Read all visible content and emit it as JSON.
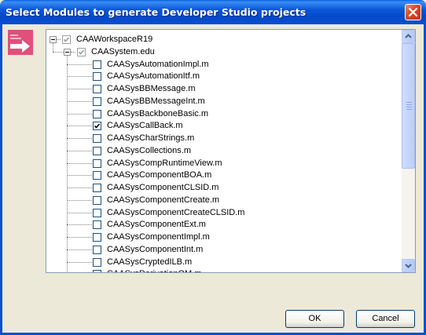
{
  "window": {
    "title": "Select Modules to generate Developer Studio projects"
  },
  "icons": {
    "side": "arrow-right-icon",
    "close": "close-icon"
  },
  "tree": {
    "root": {
      "label": "CAAWorkspaceR19",
      "checked": true,
      "expanded": true
    },
    "framework": {
      "label": "CAASystem.edu",
      "checked": true,
      "expanded": true
    },
    "modules": [
      {
        "label": "CAASysAutomationImpl.m",
        "checked": false
      },
      {
        "label": "CAASysAutomationItf.m",
        "checked": false
      },
      {
        "label": "CAASysBBMessage.m",
        "checked": false
      },
      {
        "label": "CAASysBBMessageInt.m",
        "checked": false
      },
      {
        "label": "CAASysBackboneBasic.m",
        "checked": false
      },
      {
        "label": "CAASysCallBack.m",
        "checked": true
      },
      {
        "label": "CAASysCharStrings.m",
        "checked": false
      },
      {
        "label": "CAASysCollections.m",
        "checked": false
      },
      {
        "label": "CAASysCompRuntimeView.m",
        "checked": false
      },
      {
        "label": "CAASysComponentBOA.m",
        "checked": false
      },
      {
        "label": "CAASysComponentCLSID.m",
        "checked": false
      },
      {
        "label": "CAASysComponentCreate.m",
        "checked": false
      },
      {
        "label": "CAASysComponentCreateCLSID.m",
        "checked": false
      },
      {
        "label": "CAASysComponentExt.m",
        "checked": false
      },
      {
        "label": "CAASysComponentImpl.m",
        "checked": false
      },
      {
        "label": "CAASysComponentInt.m",
        "checked": false
      },
      {
        "label": "CAASysCryptedILB.m",
        "checked": false
      },
      {
        "label": "CAASysDerivationOM.m",
        "checked": false
      }
    ]
  },
  "buttons": {
    "ok": "OK",
    "cancel": "Cancel"
  },
  "colors": {
    "title_bar": "#0a4fd1",
    "dialog_bg": "#ece9d8",
    "close_button": "#d7472a",
    "check_mark": "#21a121"
  }
}
